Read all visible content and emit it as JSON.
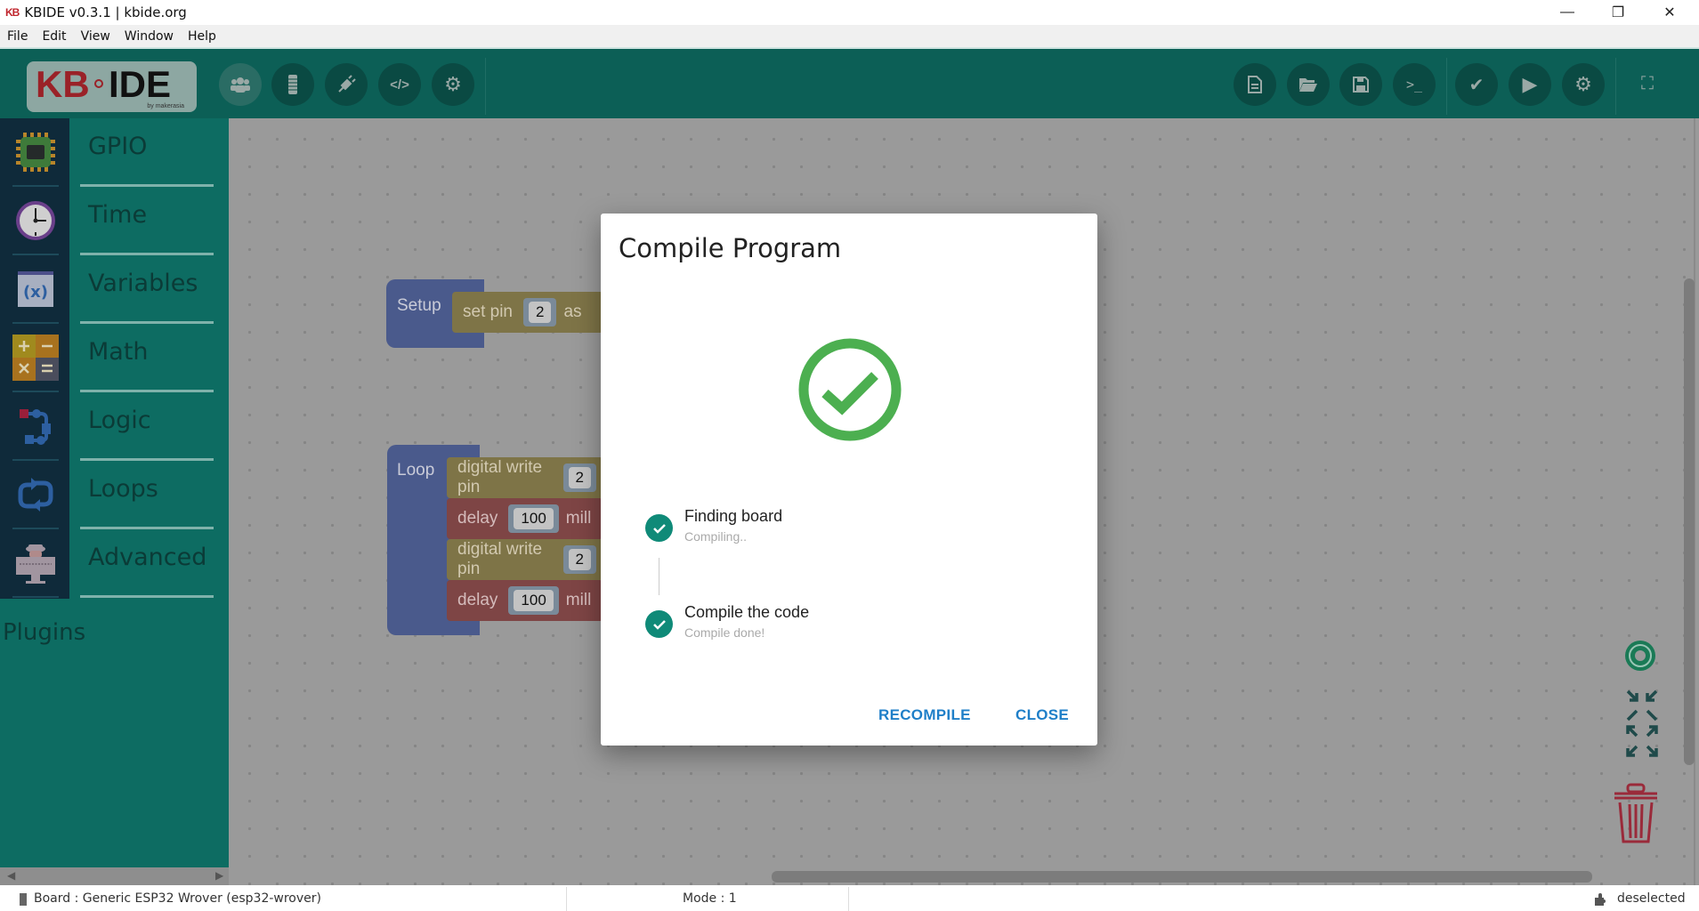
{
  "window": {
    "app_icon": "KB",
    "title": "KBIDE v0.3.1 | kbide.org",
    "controls": {
      "minimize": "—",
      "maximize": "❐",
      "close": "✕"
    }
  },
  "menu": [
    "File",
    "Edit",
    "View",
    "Window",
    "Help"
  ],
  "logo": {
    "kb": "KB",
    "ide": "IDE",
    "by": "by makerasia"
  },
  "toolbar": {
    "left_buttons": [
      {
        "name": "users-icon",
        "glyph": "👥"
      },
      {
        "name": "board-icon",
        "glyph": "▮"
      },
      {
        "name": "plug-icon",
        "glyph": "🔌"
      },
      {
        "name": "code-icon",
        "glyph": "</>"
      },
      {
        "name": "gear-icon",
        "glyph": "⚙"
      }
    ],
    "right_buttons": [
      {
        "name": "new-file-icon",
        "glyph": "🗎"
      },
      {
        "name": "open-folder-icon",
        "glyph": "📂"
      },
      {
        "name": "save-icon",
        "glyph": "💾"
      },
      {
        "name": "terminal-icon",
        "glyph": ">_"
      },
      {
        "name": "compile-check-icon",
        "glyph": "✔"
      },
      {
        "name": "run-icon",
        "glyph": "▶"
      },
      {
        "name": "settings-gears-icon",
        "glyph": "⚙"
      }
    ],
    "fullscreen_glyph": "⛶"
  },
  "sidebar": {
    "categories": [
      {
        "label": "GPIO",
        "icon": "chip-icon"
      },
      {
        "label": "Time",
        "icon": "clock-icon"
      },
      {
        "label": "Variables",
        "icon": "variable-icon"
      },
      {
        "label": "Math",
        "icon": "math-icon"
      },
      {
        "label": "Logic",
        "icon": "logic-icon"
      },
      {
        "label": "Loops",
        "icon": "loop-icon"
      },
      {
        "label": "Advanced",
        "icon": "advanced-icon"
      }
    ],
    "plugins_label": "Plugins"
  },
  "workspace": {
    "setup": {
      "label": "Setup",
      "blocks": [
        {
          "text": "set pin",
          "value": "2",
          "suffix": "as"
        }
      ]
    },
    "loop": {
      "label": "Loop",
      "blocks": [
        {
          "text": "digital write pin",
          "value": "2",
          "suffix": ""
        },
        {
          "text": "delay",
          "value": "100",
          "suffix": "mill"
        },
        {
          "text": "digital write pin",
          "value": "2",
          "suffix": ""
        },
        {
          "text": "delay",
          "value": "100",
          "suffix": "mill"
        }
      ]
    }
  },
  "dialog": {
    "title": "Compile Program",
    "success_color": "#4caf50",
    "steps": [
      {
        "name": "Finding board",
        "desc": "Compiling..",
        "status": "done"
      },
      {
        "name": "Compile the code",
        "desc": "Compile done!",
        "status": "done"
      }
    ],
    "buttons": {
      "recompile": "RECOMPILE",
      "close": "CLOSE"
    }
  },
  "statusbar": {
    "board": "Board : Generic ESP32 Wrover (esp32-wrover)",
    "mode": "Mode : 1",
    "selection": "deselected"
  }
}
